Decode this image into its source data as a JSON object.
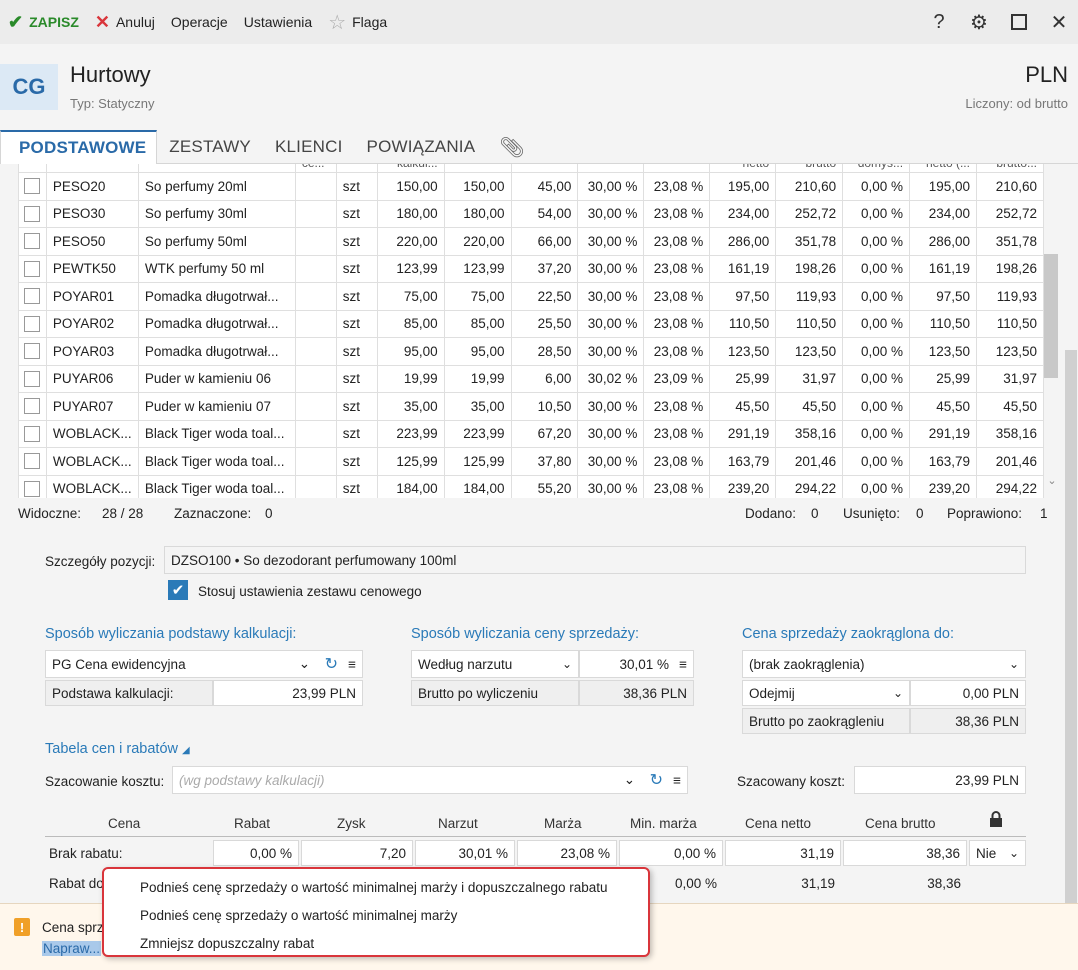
{
  "toolbar": {
    "save": "ZAPISZ",
    "cancel": "Anuluj",
    "operations": "Operacje",
    "settings": "Ustawienia",
    "flag": "Flaga",
    "help": "?"
  },
  "header": {
    "avatar": "CG",
    "title": "Hurtowy",
    "subtitle": "Typ: Statyczny",
    "currency": "PLN",
    "calc": "Liczony: od brutto"
  },
  "tabs": [
    "PODSTAWOWE",
    "ZESTAWY",
    "KLIENCI",
    "POWIĄZANIA"
  ],
  "grid": {
    "header_fragments": [
      "ce...",
      "kalkul...",
      "netto",
      "brutto",
      "domyś...",
      "netto (...",
      "brutto..."
    ],
    "rows": [
      [
        "PESO20",
        "So perfumy 20ml",
        "szt",
        "150,00",
        "150,00",
        "45,00",
        "30,00 %",
        "23,08 %",
        "195,00",
        "210,60",
        "0,00 %",
        "195,00",
        "210,60"
      ],
      [
        "PESO30",
        "So perfumy 30ml",
        "szt",
        "180,00",
        "180,00",
        "54,00",
        "30,00 %",
        "23,08 %",
        "234,00",
        "252,72",
        "0,00 %",
        "234,00",
        "252,72"
      ],
      [
        "PESO50",
        "So perfumy 50ml",
        "szt",
        "220,00",
        "220,00",
        "66,00",
        "30,00 %",
        "23,08 %",
        "286,00",
        "351,78",
        "0,00 %",
        "286,00",
        "351,78"
      ],
      [
        "PEWTK50",
        "WTK perfumy 50 ml",
        "szt",
        "123,99",
        "123,99",
        "37,20",
        "30,00 %",
        "23,08 %",
        "161,19",
        "198,26",
        "0,00 %",
        "161,19",
        "198,26"
      ],
      [
        "POYAR01",
        "Pomadka długotrwał...",
        "szt",
        "75,00",
        "75,00",
        "22,50",
        "30,00 %",
        "23,08 %",
        "97,50",
        "119,93",
        "0,00 %",
        "97,50",
        "119,93"
      ],
      [
        "POYAR02",
        "Pomadka długotrwał...",
        "szt",
        "85,00",
        "85,00",
        "25,50",
        "30,00 %",
        "23,08 %",
        "110,50",
        "110,50",
        "0,00 %",
        "110,50",
        "110,50"
      ],
      [
        "POYAR03",
        "Pomadka długotrwał...",
        "szt",
        "95,00",
        "95,00",
        "28,50",
        "30,00 %",
        "23,08 %",
        "123,50",
        "123,50",
        "0,00 %",
        "123,50",
        "123,50"
      ],
      [
        "PUYAR06",
        "Puder w kamieniu 06",
        "szt",
        "19,99",
        "19,99",
        "6,00",
        "30,02 %",
        "23,09 %",
        "25,99",
        "31,97",
        "0,00 %",
        "25,99",
        "31,97"
      ],
      [
        "PUYAR07",
        "Puder w kamieniu 07",
        "szt",
        "35,00",
        "35,00",
        "10,50",
        "30,00 %",
        "23,08 %",
        "45,50",
        "45,50",
        "0,00 %",
        "45,50",
        "45,50"
      ],
      [
        "WOBLACK...",
        "Black Tiger woda toal...",
        "szt",
        "223,99",
        "223,99",
        "67,20",
        "30,00 %",
        "23,08 %",
        "291,19",
        "358,16",
        "0,00 %",
        "291,19",
        "358,16"
      ],
      [
        "WOBLACK...",
        "Black Tiger woda toal...",
        "szt",
        "125,99",
        "125,99",
        "37,80",
        "30,00 %",
        "23,08 %",
        "163,79",
        "201,46",
        "0,00 %",
        "163,79",
        "201,46"
      ],
      [
        "WOBLACK...",
        "Black Tiger woda toal...",
        "szt",
        "184,00",
        "184,00",
        "55,20",
        "30,00 %",
        "23,08 %",
        "239,20",
        "294,22",
        "0,00 %",
        "239,20",
        "294,22"
      ]
    ]
  },
  "status": {
    "visible_label": "Widoczne:",
    "visible_value": "28 /  28",
    "selected_label": "Zaznaczone:",
    "selected_value": "0",
    "added_label": "Dodano:",
    "added_value": "0",
    "removed_label": "Usunięto:",
    "removed_value": "0",
    "fixed_label": "Poprawiono:",
    "fixed_value": "1"
  },
  "details": {
    "position_label": "Szczegóły pozycji:",
    "position_value": "DZSO100  •  So dezodorant perfumowany 100ml",
    "apply_set": "Stosuj ustawienia zestawu cenowego",
    "calc_base_title": "Sposób wyliczania podstawy kalkulacji:",
    "calc_base_value": "PG  Cena ewidencyjna",
    "calc_base_label": "Podstawa kalkulacji:",
    "calc_base_amount": "23,99 PLN",
    "sale_title": "Sposób wyliczania ceny sprzedaży:",
    "sale_method": "Według narzutu",
    "sale_percent": "30,01 %",
    "gross_calc_label": "Brutto po wyliczeniu",
    "gross_calc_value": "38,36 PLN",
    "round_title": "Cena sprzedaży zaokrąglona do:",
    "round_value": "(brak zaokrąglenia)",
    "round_mode": "Odejmij",
    "round_amount": "0,00 PLN",
    "gross_round_label": "Brutto po zaokrągleniu",
    "gross_round_value": "38,36 PLN",
    "table_title": "Tabela cen i rabatów",
    "cost_label": "Szacowanie kosztu:",
    "cost_placeholder": "(wg podstawy kalkulacji)",
    "est_cost_label": "Szacowany koszt:",
    "est_cost_value": "23,99 PLN"
  },
  "price_table": {
    "headers": [
      "Cena",
      "Rabat",
      "Zysk",
      "Narzut",
      "Marża",
      "Min. marża",
      "Cena netto",
      "Cena brutto"
    ],
    "row1": [
      "Brak rabatu:",
      "0,00 %",
      "7,20",
      "30,01 %",
      "23,08 %",
      "0,00 %",
      "31,19",
      "38,36",
      "Nie"
    ],
    "row2": [
      "Rabat do",
      "0,00 %",
      "31,19",
      "38,36"
    ]
  },
  "bottom": {
    "message": "Cena sprz",
    "link": "Napraw..."
  },
  "context_menu": [
    "Podnieś cenę sprzedaży o wartość minimalnej marży i dopuszczalnego rabatu",
    "Podnieś cenę sprzedaży o wartość minimalnej marży",
    "Zmniejsz dopuszczalny rabat"
  ],
  "colors": {
    "accent": "#2a7ab8",
    "save_green": "#2a8a2a",
    "cancel_red": "#d9353b",
    "menu_border": "#d9353b"
  }
}
